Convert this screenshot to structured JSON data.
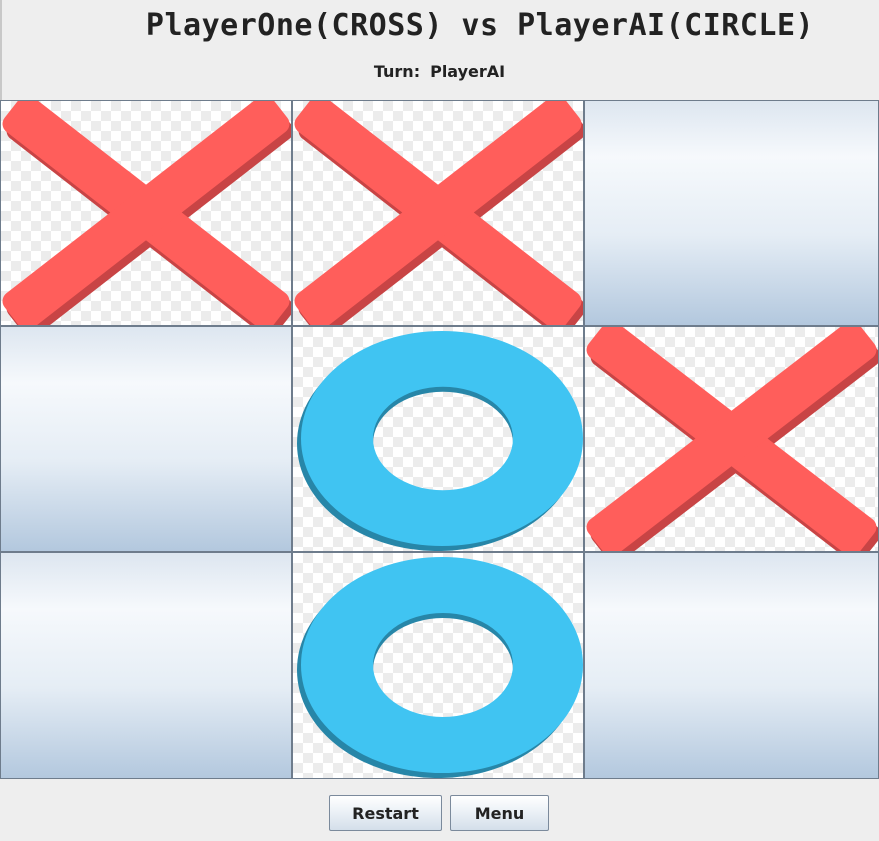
{
  "header": {
    "title": "PlayerOne(CROSS) vs PlayerAI(CIRCLE)",
    "turn_label": "Turn:",
    "turn_player": "PlayerAI"
  },
  "board": {
    "cells": [
      [
        "X",
        "X",
        ""
      ],
      [
        "",
        "O",
        "X"
      ],
      [
        "",
        "O",
        ""
      ]
    ]
  },
  "colors": {
    "cross": "#ff5e5b",
    "cross_shadow": "#c84445",
    "circle": "#40c4f2",
    "circle_shadow": "#2786a8"
  },
  "buttons": {
    "restart": "Restart",
    "menu": "Menu"
  }
}
